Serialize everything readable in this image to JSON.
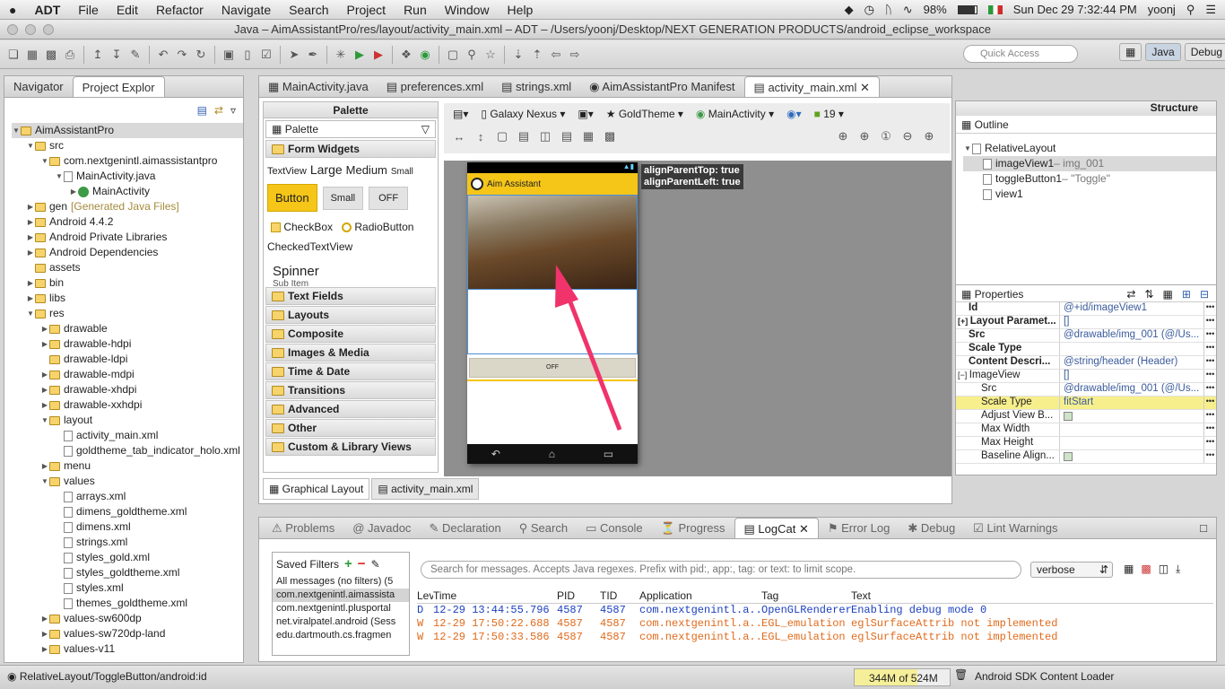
{
  "menubar": {
    "app": "ADT",
    "items": [
      "File",
      "Edit",
      "Refactor",
      "Navigate",
      "Search",
      "Project",
      "Run",
      "Window",
      "Help"
    ],
    "battery": "98%",
    "clock": "Sun Dec 29  7:32:44 PM",
    "user": "yoonj"
  },
  "window": {
    "title": "Java – AimAssistantPro/res/layout/activity_main.xml – ADT – /Users/yoonj/Desktop/NEXT GENERATION PRODUCTS/android_eclipse_workspace"
  },
  "toolbar": {
    "quick_access": "Quick Access",
    "perspectives": [
      "Java",
      "Debug"
    ]
  },
  "left_panel": {
    "tabs": [
      "Navigator",
      "Project Explor"
    ],
    "tree": [
      {
        "t": "AimAssistantPro",
        "d": 0,
        "i": "proj",
        "tw": "▼"
      },
      {
        "t": "src",
        "d": 1,
        "i": "folder",
        "tw": "▼"
      },
      {
        "t": "com.nextgenintl.aimassistantpro",
        "d": 2,
        "i": "pkg",
        "tw": "▼"
      },
      {
        "t": "MainActivity.java",
        "d": 3,
        "i": "file",
        "tw": "▼"
      },
      {
        "t": "MainActivity",
        "d": 4,
        "i": "class",
        "tw": "▶"
      },
      {
        "t": "gen",
        "d": 1,
        "i": "folder",
        "tw": "▶",
        "g": "[Generated Java Files]"
      },
      {
        "t": "Android 4.4.2",
        "d": 1,
        "i": "lib",
        "tw": "▶"
      },
      {
        "t": "Android Private Libraries",
        "d": 1,
        "i": "lib",
        "tw": "▶"
      },
      {
        "t": "Android Dependencies",
        "d": 1,
        "i": "lib",
        "tw": "▶"
      },
      {
        "t": "assets",
        "d": 1,
        "i": "folder",
        "tw": ""
      },
      {
        "t": "bin",
        "d": 1,
        "i": "folder",
        "tw": "▶"
      },
      {
        "t": "libs",
        "d": 1,
        "i": "folder",
        "tw": "▶"
      },
      {
        "t": "res",
        "d": 1,
        "i": "folder",
        "tw": "▼"
      },
      {
        "t": "drawable",
        "d": 2,
        "i": "folder",
        "tw": "▶"
      },
      {
        "t": "drawable-hdpi",
        "d": 2,
        "i": "folder",
        "tw": "▶"
      },
      {
        "t": "drawable-ldpi",
        "d": 2,
        "i": "folder",
        "tw": ""
      },
      {
        "t": "drawable-mdpi",
        "d": 2,
        "i": "folder",
        "tw": "▶"
      },
      {
        "t": "drawable-xhdpi",
        "d": 2,
        "i": "folder",
        "tw": "▶"
      },
      {
        "t": "drawable-xxhdpi",
        "d": 2,
        "i": "folder",
        "tw": "▶"
      },
      {
        "t": "layout",
        "d": 2,
        "i": "folder",
        "tw": "▼"
      },
      {
        "t": "activity_main.xml",
        "d": 3,
        "i": "file",
        "tw": ""
      },
      {
        "t": "goldtheme_tab_indicator_holo.xml",
        "d": 3,
        "i": "file",
        "tw": ""
      },
      {
        "t": "menu",
        "d": 2,
        "i": "folder",
        "tw": "▶"
      },
      {
        "t": "values",
        "d": 2,
        "i": "folder",
        "tw": "▼"
      },
      {
        "t": "arrays.xml",
        "d": 3,
        "i": "file",
        "tw": ""
      },
      {
        "t": "dimens_goldtheme.xml",
        "d": 3,
        "i": "file",
        "tw": ""
      },
      {
        "t": "dimens.xml",
        "d": 3,
        "i": "file",
        "tw": ""
      },
      {
        "t": "strings.xml",
        "d": 3,
        "i": "file",
        "tw": ""
      },
      {
        "t": "styles_gold.xml",
        "d": 3,
        "i": "file",
        "tw": ""
      },
      {
        "t": "styles_goldtheme.xml",
        "d": 3,
        "i": "file",
        "tw": ""
      },
      {
        "t": "styles.xml",
        "d": 3,
        "i": "file",
        "tw": ""
      },
      {
        "t": "themes_goldtheme.xml",
        "d": 3,
        "i": "file",
        "tw": ""
      },
      {
        "t": "values-sw600dp",
        "d": 2,
        "i": "folder",
        "tw": "▶"
      },
      {
        "t": "values-sw720dp-land",
        "d": 2,
        "i": "folder",
        "tw": "▶"
      },
      {
        "t": "values-v11",
        "d": 2,
        "i": "folder",
        "tw": "▶"
      }
    ]
  },
  "editor_tabs": [
    "MainActivity.java",
    "preferences.xml",
    "strings.xml",
    "AimAssistantPro Manifest",
    "activity_main.xml"
  ],
  "palette": {
    "title": "Palette",
    "dropdown": "Palette",
    "form_widgets": "Form Widgets",
    "textview_labels": [
      "TextView",
      "Large",
      "Medium",
      "Small"
    ],
    "button": "Button",
    "small_btn": "Small",
    "off_btn": "OFF",
    "checkbox": "CheckBox",
    "radio": "RadioButton",
    "checked_text": "CheckedTextView",
    "spinner": "Spinner",
    "spinner_sub": "Sub Item",
    "categories": [
      "Text Fields",
      "Layouts",
      "Composite",
      "Images & Media",
      "Time & Date",
      "Transitions",
      "Advanced",
      "Other",
      "Custom & Library Views"
    ]
  },
  "canvas_toolbar": {
    "device": "Galaxy Nexus",
    "theme": "GoldTheme",
    "activity": "MainActivity",
    "api": "19"
  },
  "phone": {
    "app_title": "Aim Assistant",
    "toggle": "OFF",
    "tooltip1": "alignParentTop: true",
    "tooltip2": "alignParentLeft: true"
  },
  "editor_bottom_tabs": [
    "Graphical Layout",
    "activity_main.xml"
  ],
  "structure": {
    "title": "Structure",
    "outline": "Outline",
    "nodes": [
      {
        "name": "RelativeLayout",
        "extra": ""
      },
      {
        "name": "imageView1",
        "extra": " – img_001"
      },
      {
        "name": "toggleButton1",
        "extra": " – \"Toggle\""
      },
      {
        "name": "view1",
        "extra": ""
      }
    ]
  },
  "properties": {
    "title": "Properties",
    "rows": [
      {
        "k": "Id",
        "v": "@+id/imageView1",
        "bold": true
      },
      {
        "k": "Layout Paramet...",
        "v": "[]",
        "bold": true,
        "exp": "+"
      },
      {
        "k": "Src",
        "v": "@drawable/img_001 (@/Us...",
        "bold": true
      },
      {
        "k": "Scale Type",
        "v": "",
        "bold": true
      },
      {
        "k": "Content Descri...",
        "v": "@string/header (Header)",
        "bold": true
      },
      {
        "k": "ImageView",
        "v": "[]",
        "bold": false,
        "exp": "−"
      },
      {
        "k": "Src",
        "v": "@drawable/img_001 (@/Us...",
        "bold": false,
        "ind": true
      },
      {
        "k": "Scale Type",
        "v": "fitStart",
        "bold": false,
        "ind": true,
        "hl": true
      },
      {
        "k": "Adjust View B...",
        "v": "",
        "bold": false,
        "ind": true,
        "chk": true
      },
      {
        "k": "Max Width",
        "v": "",
        "bold": false,
        "ind": true
      },
      {
        "k": "Max Height",
        "v": "",
        "bold": false,
        "ind": true
      },
      {
        "k": "Baseline Align...",
        "v": "",
        "bold": false,
        "ind": true,
        "chk": true
      }
    ]
  },
  "bottom_tabs": [
    "Problems",
    "Javadoc",
    "Declaration",
    "Search",
    "Console",
    "Progress",
    "LogCat",
    "Error Log",
    "Debug",
    "Lint Warnings"
  ],
  "logcat": {
    "saved_filters": "Saved Filters",
    "filters": [
      "All messages (no filters) (5",
      "com.nextgenintl.aimassista",
      "com.nextgenintl.plusportal",
      "net.viralpatel.android (Sess",
      "edu.dartmouth.cs.fragmen"
    ],
    "search_placeholder": "Search for messages. Accepts Java regexes. Prefix with pid:, app:, tag: or text: to limit scope.",
    "level": "verbose",
    "columns": [
      "Lev",
      "Time",
      "PID",
      "TID",
      "Application",
      "Tag",
      "Text"
    ],
    "rows": [
      {
        "lev": "D",
        "time": "12-29 13:44:55.796",
        "pid": "4587",
        "tid": "4587",
        "app": "com.nextgenintl.a...",
        "tag": "OpenGLRenderer",
        "text": "Enabling debug mode 0"
      },
      {
        "lev": "W",
        "time": "12-29 17:50:22.688",
        "pid": "4587",
        "tid": "4587",
        "app": "com.nextgenintl.a...",
        "tag": "EGL_emulation",
        "text": "eglSurfaceAttrib not implemented"
      },
      {
        "lev": "W",
        "time": "12-29 17:50:33.586",
        "pid": "4587",
        "tid": "4587",
        "app": "com.nextgenintl.a...",
        "tag": "EGL_emulation",
        "text": "eglSurfaceAttrib not implemented"
      }
    ]
  },
  "status": {
    "left": "RelativeLayout/ToggleButton/android:id",
    "memory": "344M of 524M",
    "memory_fraction": 0.66,
    "loader": "Android SDK Content Loader"
  },
  "colors": {
    "accent": "#f5c518",
    "debug_blue": "#1a3fbf",
    "warn_orange": "#e06a1b",
    "highlight_yellow": "#f7ef8c",
    "arrow": "#f0336b"
  }
}
